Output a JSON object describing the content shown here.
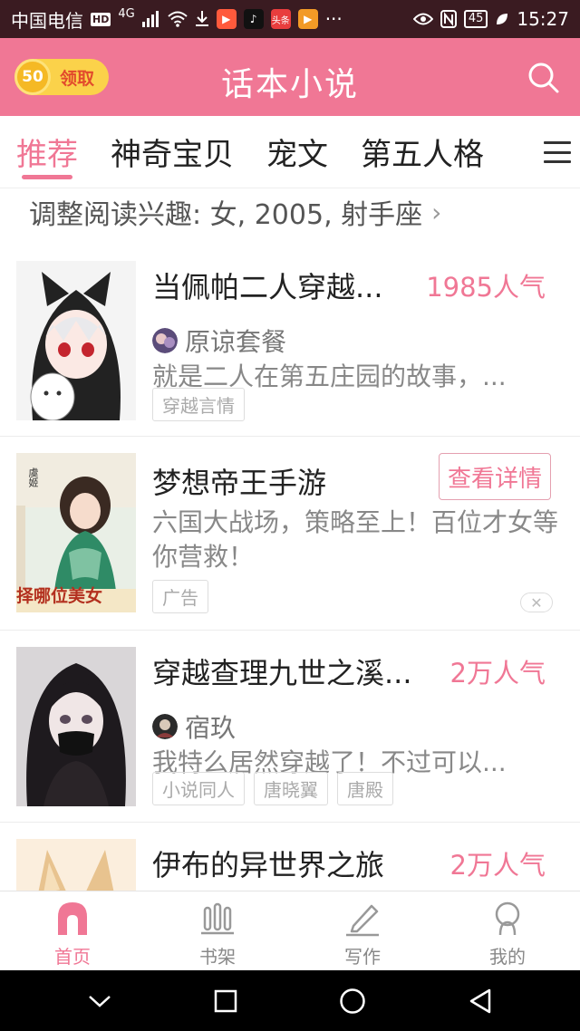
{
  "status_bar": {
    "carrier": "中国电信",
    "hd": "HD",
    "net": "4G",
    "battery": "45",
    "time": "15:27",
    "app_icons": [
      "video-app-icon",
      "tiktok-icon",
      "toutiao-icon",
      "play-app-icon"
    ],
    "more": "···"
  },
  "header": {
    "coin_amount": "50",
    "coin_label": "领取",
    "title": "话本小说",
    "accent_color": "#f07795"
  },
  "tabs": [
    {
      "label": "推荐",
      "active": true
    },
    {
      "label": "神奇宝贝",
      "active": false
    },
    {
      "label": "宠文",
      "active": false
    },
    {
      "label": "第五人格",
      "active": false
    }
  ],
  "interest": {
    "text": "调整阅读兴趣: 女, 2005, 射手座",
    "chevron": "›"
  },
  "feed": [
    {
      "title": "当佩帕二人穿越...",
      "popularity": "1985人气",
      "author": "原谅套餐",
      "description": "就是二人在第五庄园的故事，...",
      "tags": [
        "穿越言情"
      ]
    },
    {
      "title": "梦想帝王手游",
      "button": "查看详情",
      "description": "六国大战场，策略至上！百位才女等你营救！",
      "tags": [
        "广告"
      ],
      "close": "✕",
      "thumb_top_text": "虞姬",
      "thumb_bottom_text": "择哪位美女"
    },
    {
      "title": "穿越查理九世之溪...",
      "popularity": "2万人气",
      "author": "宿玖",
      "description": "我特么居然穿越了！不过可以...",
      "tags": [
        "小说同人",
        "唐晓翼",
        "唐殿"
      ]
    },
    {
      "title": "伊布的异世界之旅",
      "popularity": "2万人气"
    }
  ],
  "bottom_nav": [
    {
      "label": "首页",
      "icon": "home-icon",
      "active": true
    },
    {
      "label": "书架",
      "icon": "bookshelf-icon",
      "active": false
    },
    {
      "label": "写作",
      "icon": "pencil-icon",
      "active": false
    },
    {
      "label": "我的",
      "icon": "profile-icon",
      "active": false
    }
  ]
}
